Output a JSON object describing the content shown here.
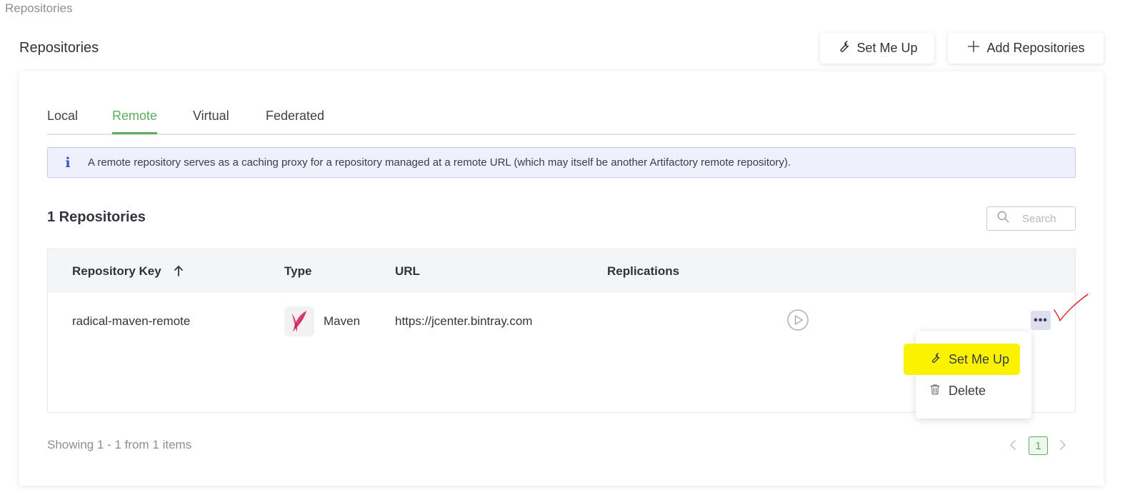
{
  "breadcrumb": "Repositories",
  "page_title": "Repositories",
  "header_buttons": {
    "set_me_up": "Set Me Up",
    "add_repositories": "Add Repositories"
  },
  "tabs": [
    {
      "label": "Local",
      "active": false
    },
    {
      "label": "Remote",
      "active": true
    },
    {
      "label": "Virtual",
      "active": false
    },
    {
      "label": "Federated",
      "active": false
    }
  ],
  "info": {
    "icon": "i",
    "text": "A remote repository serves as a caching proxy for a repository managed at a remote URL (which may itself be another Artifactory remote repository)."
  },
  "count_title": "1 Repositories",
  "search": {
    "placeholder": "Search",
    "value": ""
  },
  "table": {
    "columns": [
      "Repository Key",
      "Type",
      "URL",
      "Replications"
    ],
    "sort": {
      "column": "Repository Key",
      "direction": "ascending"
    },
    "rows": [
      {
        "key": "radical-maven-remote",
        "type": "Maven",
        "url": "https://jcenter.bintray.com",
        "replications": ""
      }
    ]
  },
  "actions_button": "•••",
  "context_menu": {
    "items": [
      {
        "label": "Set Me Up",
        "icon": "wrench-icon",
        "highlighted": true
      },
      {
        "label": "Delete",
        "icon": "trash-icon",
        "highlighted": false
      }
    ]
  },
  "footer": {
    "showing": "Showing 1 - 1 from 1 items"
  },
  "pagination": {
    "current_page": "1"
  },
  "colors": {
    "accent": "#5cae5e",
    "info_bg": "#eef0fb",
    "info_icon": "#3d4fc4",
    "highlight": "#fbf200",
    "annotation": "#e02020"
  }
}
